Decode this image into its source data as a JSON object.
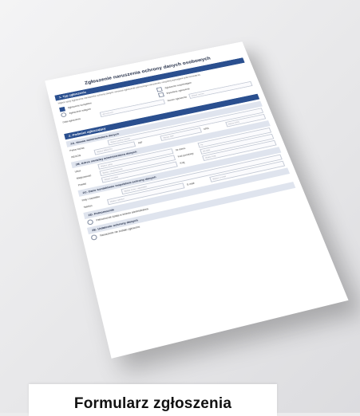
{
  "document": {
    "title": "Zgłoszenie naruszenia ochrony danych osobowych",
    "sections": {
      "s1": "1. Typ zgłoszenia",
      "s2": "2. Podmiot zgłaszający"
    },
    "intro": "Wybór opcji Zgłoszenie naruszenia ochrony danych oznacza zgłoszenie pierwszego naruszenia; uzupełnij wymagane pola formularza.",
    "type_options": {
      "complete": "Zgłoszenie kompletne",
      "initial": "Zgłoszenie wstępne",
      "followup": "Zgłoszenie uzupełniające",
      "withdraw": "Wycofanie zgłoszenia"
    },
    "type_fields": {
      "date_label": "Data zgłoszenia",
      "date_placeholder": "dd-mm-rrrr",
      "number_label": "Numer zgłoszenia",
      "number_placeholder": "Wpisz numer"
    },
    "subsections": {
      "a": "2A. Nazwa administratora danych",
      "b": "2B. Adres siedziby administratora danych",
      "c": "2C. Dane kontaktowe inspektora ochrony danych",
      "d": "2D. Pełnomocnik",
      "e": "2E. Ustalenie ochrony danych"
    },
    "admin_fields": [
      {
        "label": "Pełna nazwa",
        "placeholder": "Wpisz pełną nazwę"
      },
      {
        "label": "REGON",
        "placeholder": "Wpisz REGON"
      },
      {
        "label": "NIP",
        "placeholder": "Wpisz NIP"
      },
      {
        "label": "KRS",
        "placeholder": "Wpisz KRS"
      }
    ],
    "address_fields": [
      {
        "label": "Ulica",
        "placeholder": "Wpisz ulicę"
      },
      {
        "label": "Nr domu",
        "placeholder": "Nr"
      },
      {
        "label": "Miejscowość",
        "placeholder": "Wpisz miejscowość"
      },
      {
        "label": "Kod pocztowy",
        "placeholder": "00-000"
      },
      {
        "label": "Powiat",
        "placeholder": "Wpisz powiat"
      },
      {
        "label": "Kraj",
        "placeholder": "Wpisz kraj"
      }
    ],
    "contact_fields": [
      {
        "label": "Imię i nazwisko",
        "placeholder": "Wpisz imię i nazwisko"
      },
      {
        "label": "Telefon",
        "placeholder": "Wpisz telefon"
      },
      {
        "label": "E-mail",
        "placeholder": "Wpisz e-mail"
      }
    ],
    "proxy_option": "Pełnomocnik działa w imieniu administratora",
    "final_option": "Naruszenie nie zostało zgłoszone"
  },
  "caption": {
    "text": "Formularz zgłoszenia"
  }
}
